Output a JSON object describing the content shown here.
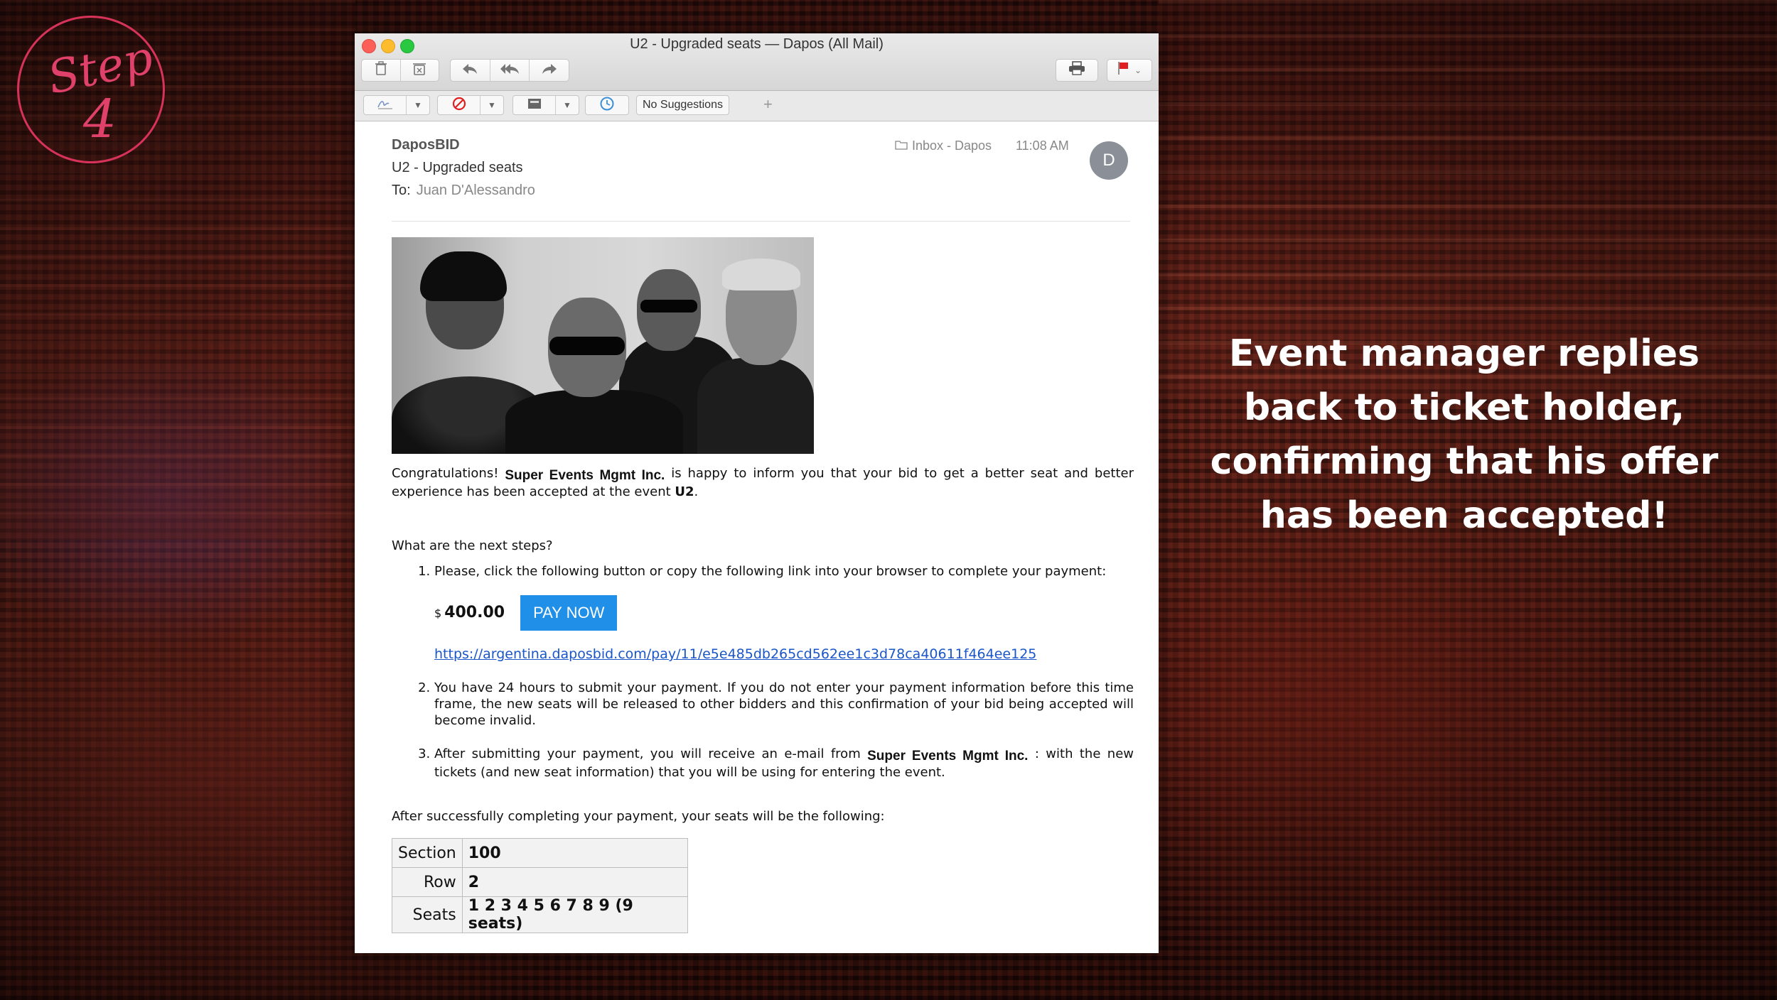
{
  "badge": {
    "word": "Step",
    "number": "4"
  },
  "caption": "Event manager replies back to ticket holder, confirming that his offer has been accepted!",
  "window": {
    "title": "U2 - Upgraded seats — Dapos (All Mail)",
    "no_suggestions": "No Suggestions",
    "plus": "+"
  },
  "icons": [
    "trash-icon",
    "junk-icon",
    "reply-icon",
    "reply-all-icon",
    "forward-icon",
    "print-icon",
    "flag-icon",
    "signature-icon",
    "block-icon",
    "archive-icon",
    "reminder-icon",
    "folder-icon"
  ],
  "colors": {
    "badge": "#d7335a",
    "pay_button": "#1f8fe8",
    "link": "#1a56c8",
    "flag": "#e02020"
  },
  "mail": {
    "sender": "DaposBID",
    "subject": "U2 - Upgraded seats",
    "to_label": "To:",
    "to_name": "Juan D'Alessandro",
    "mailbox": "Inbox - Dapos",
    "time": "11:08 AM",
    "avatar_initial": "D"
  },
  "body": {
    "congrats_prefix": "Congratulations!",
    "company": "Super Events Mgmt Inc.",
    "congrats_suffix": "is happy to inform you that your bid to get a better seat and better experience has been accepted at the event",
    "event": "U2",
    "question": "What are the next steps?",
    "step1": "Please, click the following button or copy the following link into your browser to complete your payment:",
    "currency": "$",
    "amount": "400.00",
    "pay_label": "PAY NOW",
    "pay_link": "https://argentina.daposbid.com/pay/11/e5e485db265cd562ee1c3d78ca40611f464ee125",
    "step2": "You have 24 hours to submit your payment. If you do not enter your payment information before this time frame, the new seats will be released to other bidders and this confirmation of your bid being accepted will become invalid.",
    "step3_prefix": "After submitting your payment, you will receive an e-mail from",
    "step3_suffix": ": with the new tickets (and new seat information) that you will be using for entering the event.",
    "after": "After successfully completing your payment, your seats will be the following:",
    "seats_table": [
      {
        "label": "Section",
        "value": "100"
      },
      {
        "label": "Row",
        "value": "2"
      },
      {
        "label": "Seats",
        "value": "1 2 3 4 5 6 7 8 9 (9 seats)"
      }
    ]
  }
}
